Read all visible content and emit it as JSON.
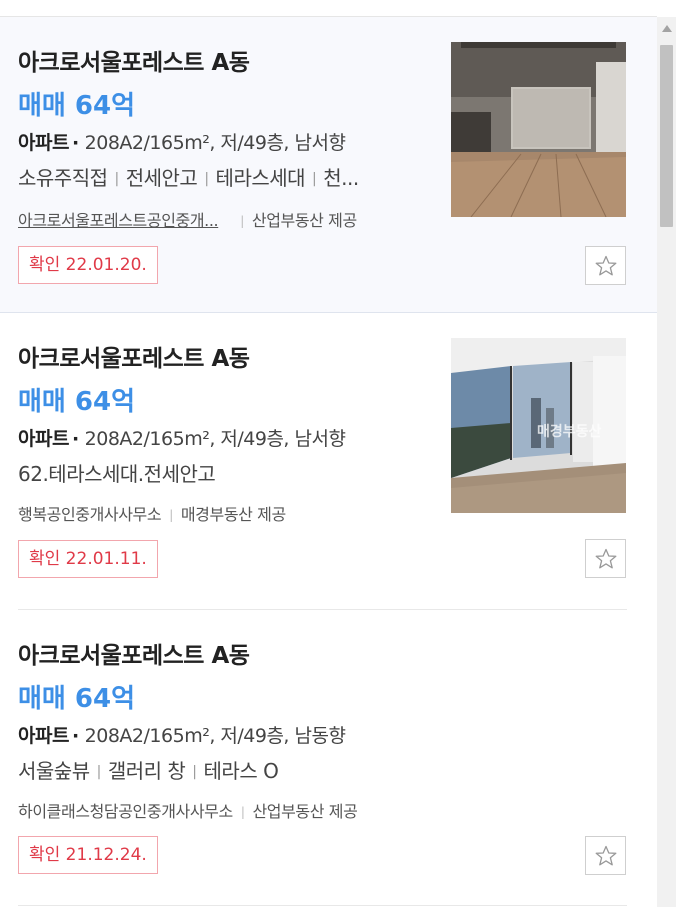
{
  "listings": [
    {
      "title": "아크로서울포레스트 A동",
      "price": "매매 64억",
      "type": "아파트",
      "spec": "208A2/165m², 저/49층, 남서향",
      "features": [
        "소유주직접",
        "전세안고",
        "테라스세대",
        "천..."
      ],
      "agent": "아크로서울포레스트공인중개...",
      "provider": "산업부동산 제공",
      "confirm": "확인 22.01.20."
    },
    {
      "title": "아크로서울포레스트 A동",
      "price": "매매 64억",
      "type": "아파트",
      "spec": "208A2/165m², 저/49층, 남서향",
      "description": "62.테라스세대.전세안고",
      "agent": "행복공인중개사사무소",
      "provider": "매경부동산 제공",
      "confirm": "확인 22.01.11.",
      "watermark": "매경부동산"
    },
    {
      "title": "아크로서울포레스트 A동",
      "price": "매매 64억",
      "type": "아파트",
      "spec": "208A2/165m², 저/49층, 남동향",
      "features": [
        "서울숲뷰",
        "갤러리 창",
        "테라스 O"
      ],
      "agent": "하이클래스청담공인중개사사무소",
      "provider": "산업부동산 제공",
      "confirm": "확인 21.12.24."
    }
  ],
  "icons": {
    "favorite": "star-outline-icon",
    "scroll_up": "triangle-up-icon"
  },
  "colors": {
    "price": "#3d8fe6",
    "confirm": "#e03a48",
    "selected_bg": "#f8f9fd"
  }
}
